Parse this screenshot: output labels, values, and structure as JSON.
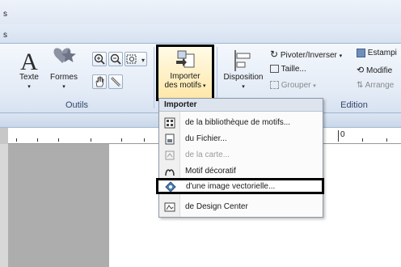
{
  "window": {
    "title_fragment": "s",
    "tab_fragment": "s"
  },
  "ribbon": {
    "groups": [
      {
        "label": "Outils"
      },
      {
        "label": "Edition"
      }
    ],
    "texte_label": "Texte",
    "formes_label": "Formes",
    "import_label_line1": "Importer",
    "import_label_line2": "des motifs",
    "disposition_label": "Disposition",
    "pivoter_label": "Pivoter/Inverser",
    "taille_label": "Taille...",
    "grouper_label": "Grouper",
    "estampille_label": "Estampi",
    "modifier_label": "Modifie",
    "arrange_label": "Arrange"
  },
  "ruler": {
    "marker": "0"
  },
  "menu": {
    "header": "Importer",
    "items": [
      {
        "label": "de la bibliothèque de motifs...",
        "icon": "library-icon",
        "enabled": true
      },
      {
        "label": "du Fichier...",
        "icon": "file-icon",
        "enabled": true
      },
      {
        "label": "de la carte...",
        "icon": "card-icon",
        "enabled": false
      },
      {
        "label": "Motif décoratif",
        "icon": "decorative-icon",
        "enabled": true
      },
      {
        "label": "d'une image vectorielle...",
        "icon": "vector-image-icon",
        "enabled": true
      },
      {
        "label": "de Design Center",
        "icon": "design-center-icon",
        "enabled": true
      }
    ],
    "selected_index": 4
  }
}
